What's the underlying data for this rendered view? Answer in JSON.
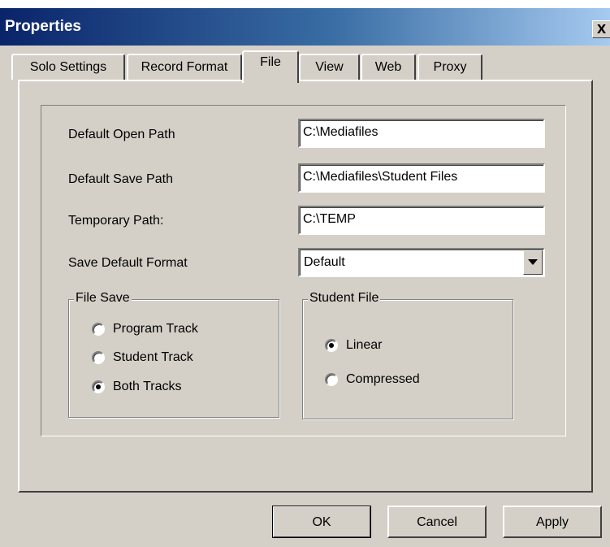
{
  "window": {
    "title": "Properties",
    "close_glyph": "x"
  },
  "tabs": [
    {
      "label": "Solo Settings"
    },
    {
      "label": "Record Format"
    },
    {
      "label": "File",
      "active": true
    },
    {
      "label": "View"
    },
    {
      "label": "Web"
    },
    {
      "label": "Proxy"
    }
  ],
  "fields": {
    "default_open_path": {
      "label": "Default Open Path",
      "value": "C:\\Mediafiles"
    },
    "default_save_path": {
      "label": "Default Save Path",
      "value": "C:\\Mediafiles\\Student Files"
    },
    "temporary_path": {
      "label": "Temporary Path:",
      "value": "C:\\TEMP"
    },
    "save_default_format": {
      "label": "Save Default Format",
      "value": "Default"
    }
  },
  "file_save": {
    "title": "File Save",
    "options": [
      {
        "label": "Program Track",
        "checked": false
      },
      {
        "label": "Student Track",
        "checked": false
      },
      {
        "label": "Both Tracks",
        "checked": true
      }
    ]
  },
  "student_file": {
    "title": "Student File",
    "options": [
      {
        "label": "Linear",
        "checked": true
      },
      {
        "label": "Compressed",
        "checked": false
      }
    ]
  },
  "buttons": {
    "ok": "OK",
    "cancel": "Cancel",
    "apply": "Apply"
  }
}
